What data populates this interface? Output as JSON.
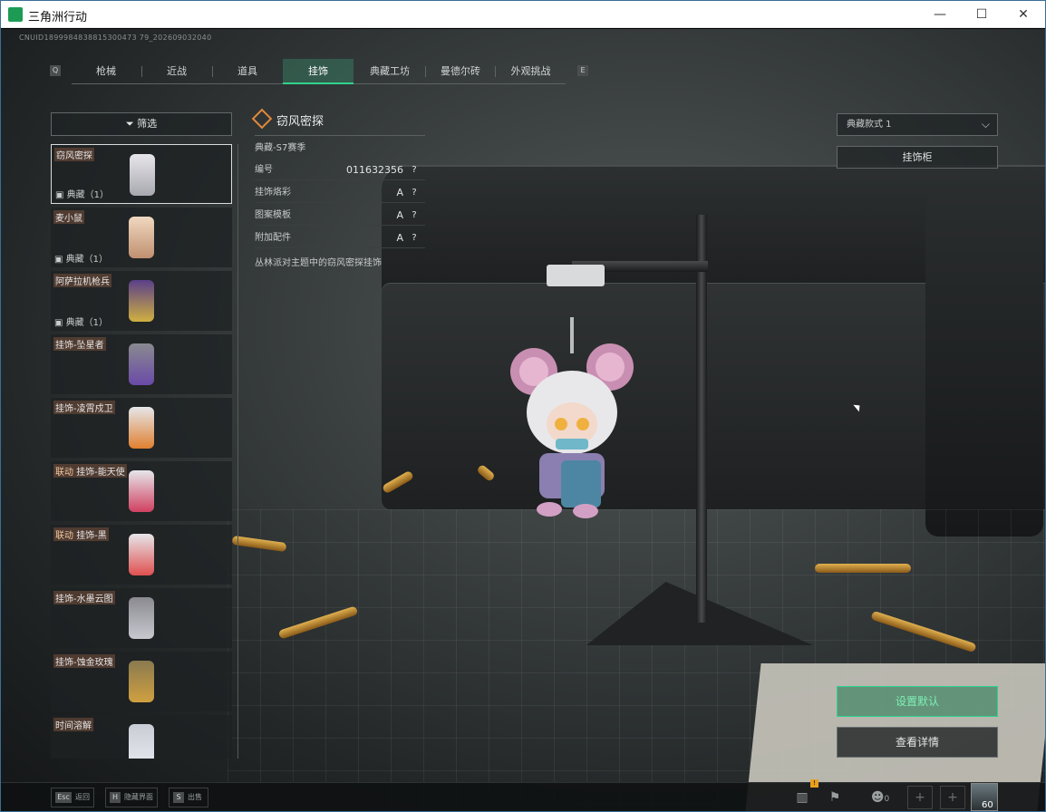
{
  "window": {
    "title": "三角洲行动",
    "minimize": "—",
    "maximize": "☐",
    "close": "✕"
  },
  "uid_text": "CNUID1899984838815300473 79_202609032040",
  "tabs": [
    {
      "label": "枪械"
    },
    {
      "label": "近战"
    },
    {
      "label": "道具"
    },
    {
      "label": "挂饰"
    },
    {
      "label": "典藏工坊"
    },
    {
      "label": "曼德尔砖"
    },
    {
      "label": "外观挑战"
    }
  ],
  "tab_prev_key": "Q",
  "tab_next_key": "E",
  "filter": {
    "label": "筛选"
  },
  "items": [
    {
      "name": "窃风密探",
      "tag": "",
      "sub": "典藏（1）"
    },
    {
      "name": "麦小鼠",
      "tag": "",
      "sub": "典藏（1）"
    },
    {
      "name": "阿萨拉机枪兵",
      "tag": "",
      "sub": "典藏（1）"
    },
    {
      "name": "挂饰-坠星者",
      "tag": "",
      "sub": ""
    },
    {
      "name": "挂饰-凌霄戍卫",
      "tag": "",
      "sub": ""
    },
    {
      "name": "挂饰-能天使",
      "tag": "联动",
      "sub": ""
    },
    {
      "name": "挂饰-黑",
      "tag": "联动",
      "sub": ""
    },
    {
      "name": "挂饰-水墨云图",
      "tag": "",
      "sub": ""
    },
    {
      "name": "挂饰-蚀金玫瑰",
      "tag": "",
      "sub": ""
    },
    {
      "name": "时间溶解",
      "tag": "",
      "sub": ""
    }
  ],
  "detail": {
    "title": "窃风密探",
    "season": "典藏-S7赛季",
    "rows": [
      {
        "label": "编号",
        "value": "011632356",
        "help": "?"
      },
      {
        "label": "挂饰烙彩",
        "value": "A",
        "help": "?"
      },
      {
        "label": "图案模板",
        "value": "A",
        "help": "?"
      },
      {
        "label": "附加配件",
        "value": "A",
        "help": "?"
      }
    ],
    "description": "丛林派对主题中的窃风密探挂饰"
  },
  "style_select": {
    "value": "典藏款式 1"
  },
  "cabinet_button": "挂饰柜",
  "set_default_button": "设置默认",
  "view_detail_button": "查看详情",
  "bottom": {
    "esc": {
      "key": "Esc",
      "label": "返回"
    },
    "hide": {
      "key": "H",
      "label": "隐藏界面"
    },
    "sell": {
      "key": "S",
      "label": "出售"
    },
    "badge": "!",
    "friends_count": "0",
    "avatar_level": "60"
  },
  "colors": {
    "accent": "#2fd38c",
    "tag_bg": "#785a3c",
    "detail_icon": "#e0883a"
  }
}
